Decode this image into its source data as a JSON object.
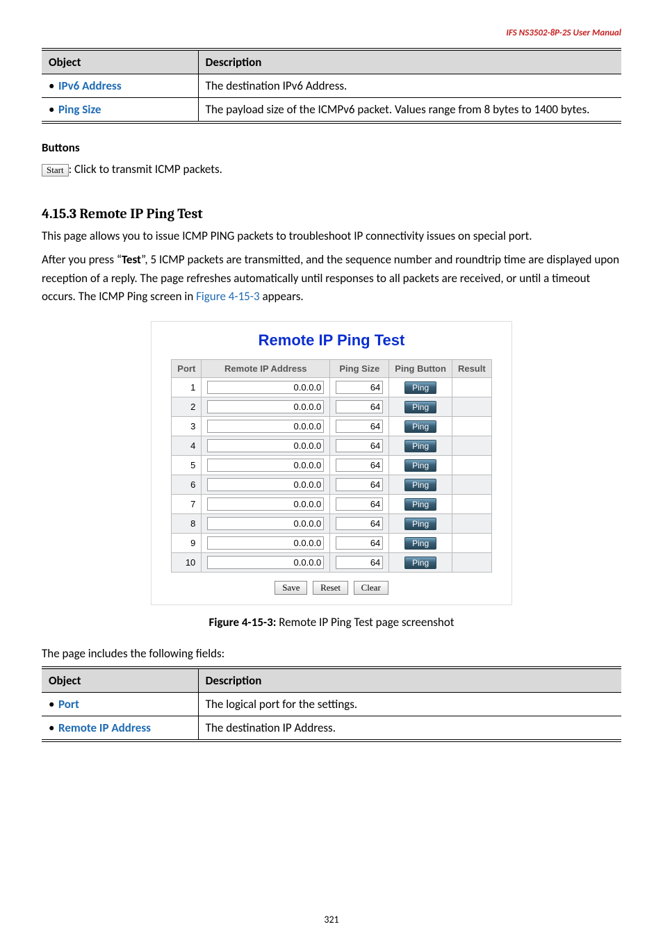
{
  "doc_header": "IFS  NS3502-8P-2S  User  Manual",
  "table1": {
    "headers": {
      "object": "Object",
      "description": "Description"
    },
    "rows": [
      {
        "label": "IPv6 Address",
        "desc": "The destination IPv6 Address."
      },
      {
        "label": "Ping Size",
        "desc": "The payload size of the ICMPv6 packet. Values range from 8 bytes to 1400 bytes."
      }
    ]
  },
  "buttons_heading": "Buttons",
  "start_button": "Start",
  "start_desc": ": Click to transmit ICMP packets.",
  "section_number": "4.15.3 ",
  "section_title": "Remote IP Ping Test",
  "para1": "This page allows you to issue ICMP PING packets to troubleshoot IP connectivity issues on special port.",
  "para2_a": "After you press “",
  "para2_b": "Test",
  "para2_c": "”, 5 ICMP packets are transmitted, and the sequence number and roundtrip time are displayed upon reception of a reply. The page refreshes automatically until responses to all packets are received, or until a timeout occurs. The ICMP Ping screen in ",
  "para2_link": "Figure 4-15-3",
  "para2_d": " appears.",
  "figure": {
    "title": "Remote IP Ping Test",
    "headers": {
      "port": "Port",
      "ip": "Remote IP Address",
      "size": "Ping Size",
      "button": "Ping Button",
      "result": "Result"
    },
    "rows": [
      {
        "port": "1",
        "ip": "0.0.0.0",
        "size": "64",
        "btn": "Ping"
      },
      {
        "port": "2",
        "ip": "0.0.0.0",
        "size": "64",
        "btn": "Ping"
      },
      {
        "port": "3",
        "ip": "0.0.0.0",
        "size": "64",
        "btn": "Ping"
      },
      {
        "port": "4",
        "ip": "0.0.0.0",
        "size": "64",
        "btn": "Ping"
      },
      {
        "port": "5",
        "ip": "0.0.0.0",
        "size": "64",
        "btn": "Ping"
      },
      {
        "port": "6",
        "ip": "0.0.0.0",
        "size": "64",
        "btn": "Ping"
      },
      {
        "port": "7",
        "ip": "0.0.0.0",
        "size": "64",
        "btn": "Ping"
      },
      {
        "port": "8",
        "ip": "0.0.0.0",
        "size": "64",
        "btn": "Ping"
      },
      {
        "port": "9",
        "ip": "0.0.0.0",
        "size": "64",
        "btn": "Ping"
      },
      {
        "port": "10",
        "ip": "0.0.0.0",
        "size": "64",
        "btn": "Ping"
      }
    ],
    "buttons": {
      "save": "Save",
      "reset": "Reset",
      "clear": "Clear"
    }
  },
  "caption_strong": "Figure 4-15-3:",
  "caption_rest": " Remote IP Ping Test page screenshot",
  "fields_intro": "The page includes the following fields:",
  "table2": {
    "headers": {
      "object": "Object",
      "description": "Description"
    },
    "rows": [
      {
        "label": "Port",
        "desc": "The logical port for the settings."
      },
      {
        "label": "Remote IP Address",
        "desc": "The destination IP Address."
      }
    ]
  },
  "page_number": "321"
}
